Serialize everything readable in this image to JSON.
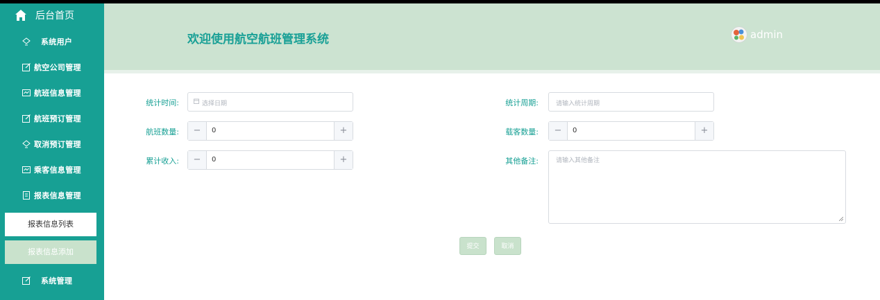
{
  "sidebar": {
    "home_label": "后台首页",
    "items": [
      {
        "label": "系统用户",
        "icon": "lightbulb-icon"
      },
      {
        "label": "航空公司管理",
        "icon": "edit-icon"
      },
      {
        "label": "航班信息管理",
        "icon": "list-icon"
      },
      {
        "label": "航班预订管理",
        "icon": "edit-icon"
      },
      {
        "label": "取消预订管理",
        "icon": "lightbulb-icon"
      },
      {
        "label": "乘客信息管理",
        "icon": "list-icon"
      },
      {
        "label": "报表信息管理",
        "icon": "document-icon"
      }
    ],
    "submenu": [
      {
        "label": "报表信息列表"
      },
      {
        "label": "报表信息添加"
      }
    ],
    "last_item": {
      "label": "系统管理",
      "icon": "edit-icon"
    }
  },
  "header": {
    "title": "欢迎使用航空航班管理系统",
    "user": "admin"
  },
  "form": {
    "stat_time": {
      "label": "统计时间:",
      "placeholder": "选择日期"
    },
    "stat_period": {
      "label": "统计周期:",
      "placeholder": "请输入统计周期"
    },
    "flight_count": {
      "label": "航班数量:",
      "value": "0"
    },
    "passenger_count": {
      "label": "载客数量:",
      "value": "0"
    },
    "total_income": {
      "label": "累计收入:",
      "value": "0"
    },
    "notes": {
      "label": "其他备注:",
      "placeholder": "请输入其他备注"
    },
    "submit_label": "提交",
    "cancel_label": "取消"
  },
  "colors": {
    "accent": "#17a094",
    "header_bg": "#cce3d1",
    "button_bg": "#c9e2cc"
  }
}
